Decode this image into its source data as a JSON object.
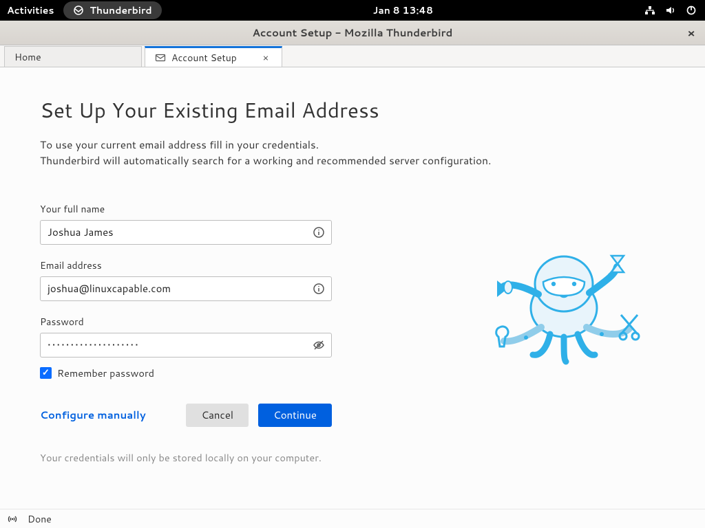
{
  "gnome": {
    "activities": "Activities",
    "app_name": "Thunderbird",
    "clock": "Jan 8  13:48"
  },
  "titlebar": {
    "title": "Account Setup - Mozilla Thunderbird"
  },
  "tabs": {
    "home": "Home",
    "account_setup": "Account Setup"
  },
  "page": {
    "heading": "Set Up Your Existing Email Address",
    "desc_line1": "To use your current email address fill in your credentials.",
    "desc_line2": "Thunderbird will automatically search for a working and recommended server configuration."
  },
  "form": {
    "full_name_label": "Your full name",
    "full_name_value": "Joshua James",
    "email_label": "Email address",
    "email_value": "joshua@linuxcapable.com",
    "password_label": "Password",
    "password_value": "••••••••••••••••••••",
    "remember_label": "Remember password",
    "configure_manually": "Configure manually",
    "cancel": "Cancel",
    "continue": "Continue",
    "note": "Your credentials will only be stored locally on your computer."
  },
  "status": {
    "text": "Done"
  }
}
